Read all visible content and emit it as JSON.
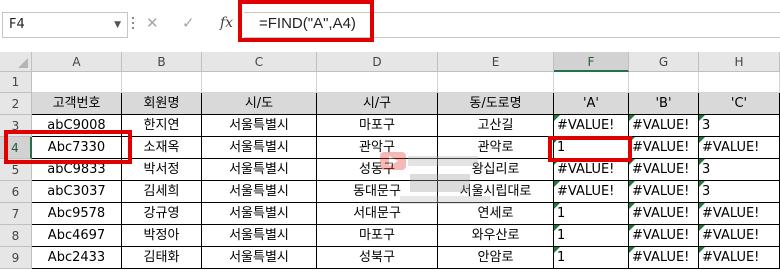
{
  "formula_bar": {
    "name_box": "F4",
    "cancel_icon": "✕",
    "enter_icon": "✓",
    "fx_label": "fx",
    "formula": "=FIND(\"A\",A4)"
  },
  "columns": [
    "A",
    "B",
    "C",
    "D",
    "E",
    "F",
    "G",
    "H"
  ],
  "rows": [
    "1",
    "2",
    "3",
    "4",
    "5",
    "6",
    "7",
    "8",
    "9"
  ],
  "table": {
    "headers": [
      "고객번호",
      "회원명",
      "시/도",
      "시/구",
      "동/도로명",
      "'A'",
      "'B'",
      "'C'"
    ],
    "data": [
      [
        "abC9008",
        "한지연",
        "서울특별시",
        "마포구",
        "고산길",
        "#VALUE!",
        "#VALUE!",
        "3"
      ],
      [
        "Abc7330",
        "소재옥",
        "서울특별시",
        "관악구",
        "관악로",
        "1",
        "#VALUE!",
        "#VALUE!"
      ],
      [
        "abC9833",
        "박서정",
        "서울특별시",
        "성동구",
        "왕십리로",
        "#VALUE!",
        "#VALUE!",
        "3"
      ],
      [
        "abC3037",
        "김세희",
        "서울특별시",
        "동대문구",
        "서울시립대로",
        "#VALUE!",
        "#VALUE!",
        "3"
      ],
      [
        "Abc9578",
        "강규영",
        "서울특별시",
        "서대문구",
        "연세로",
        "1",
        "#VALUE!",
        "#VALUE!"
      ],
      [
        "Abc4697",
        "박정아",
        "서울특별시",
        "마포구",
        "와우산로",
        "1",
        "#VALUE!",
        "#VALUE!"
      ],
      [
        "Abc2433",
        "김태화",
        "서울특별시",
        "성북구",
        "안암로",
        "1",
        "#VALUE!",
        "#VALUE!"
      ]
    ]
  },
  "colors": {
    "highlight_box": "#e00000",
    "header_fill": "#d9d9d9",
    "selected_accent": "#217346"
  }
}
